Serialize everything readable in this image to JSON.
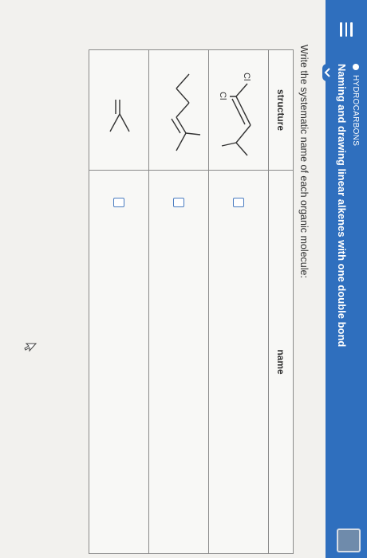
{
  "header": {
    "topic": "HYDROCARBONS",
    "lesson_title": "Naming and drawing linear alkenes with one double bond",
    "menu_icon": "menu-icon",
    "chevron_icon": "chevron-down-icon"
  },
  "instruction": "Write the systematic name of each organic molecule:",
  "table": {
    "headers": {
      "structure": "structure",
      "name": "name"
    },
    "rows": [
      {
        "atom_labels": [
          "Cl",
          "Cl"
        ],
        "name_value": ""
      },
      {
        "atom_labels": [],
        "name_value": ""
      },
      {
        "atom_labels": [],
        "name_value": ""
      }
    ]
  },
  "colors": {
    "accent": "#2f6fbe",
    "background": "#f2f1ee"
  }
}
